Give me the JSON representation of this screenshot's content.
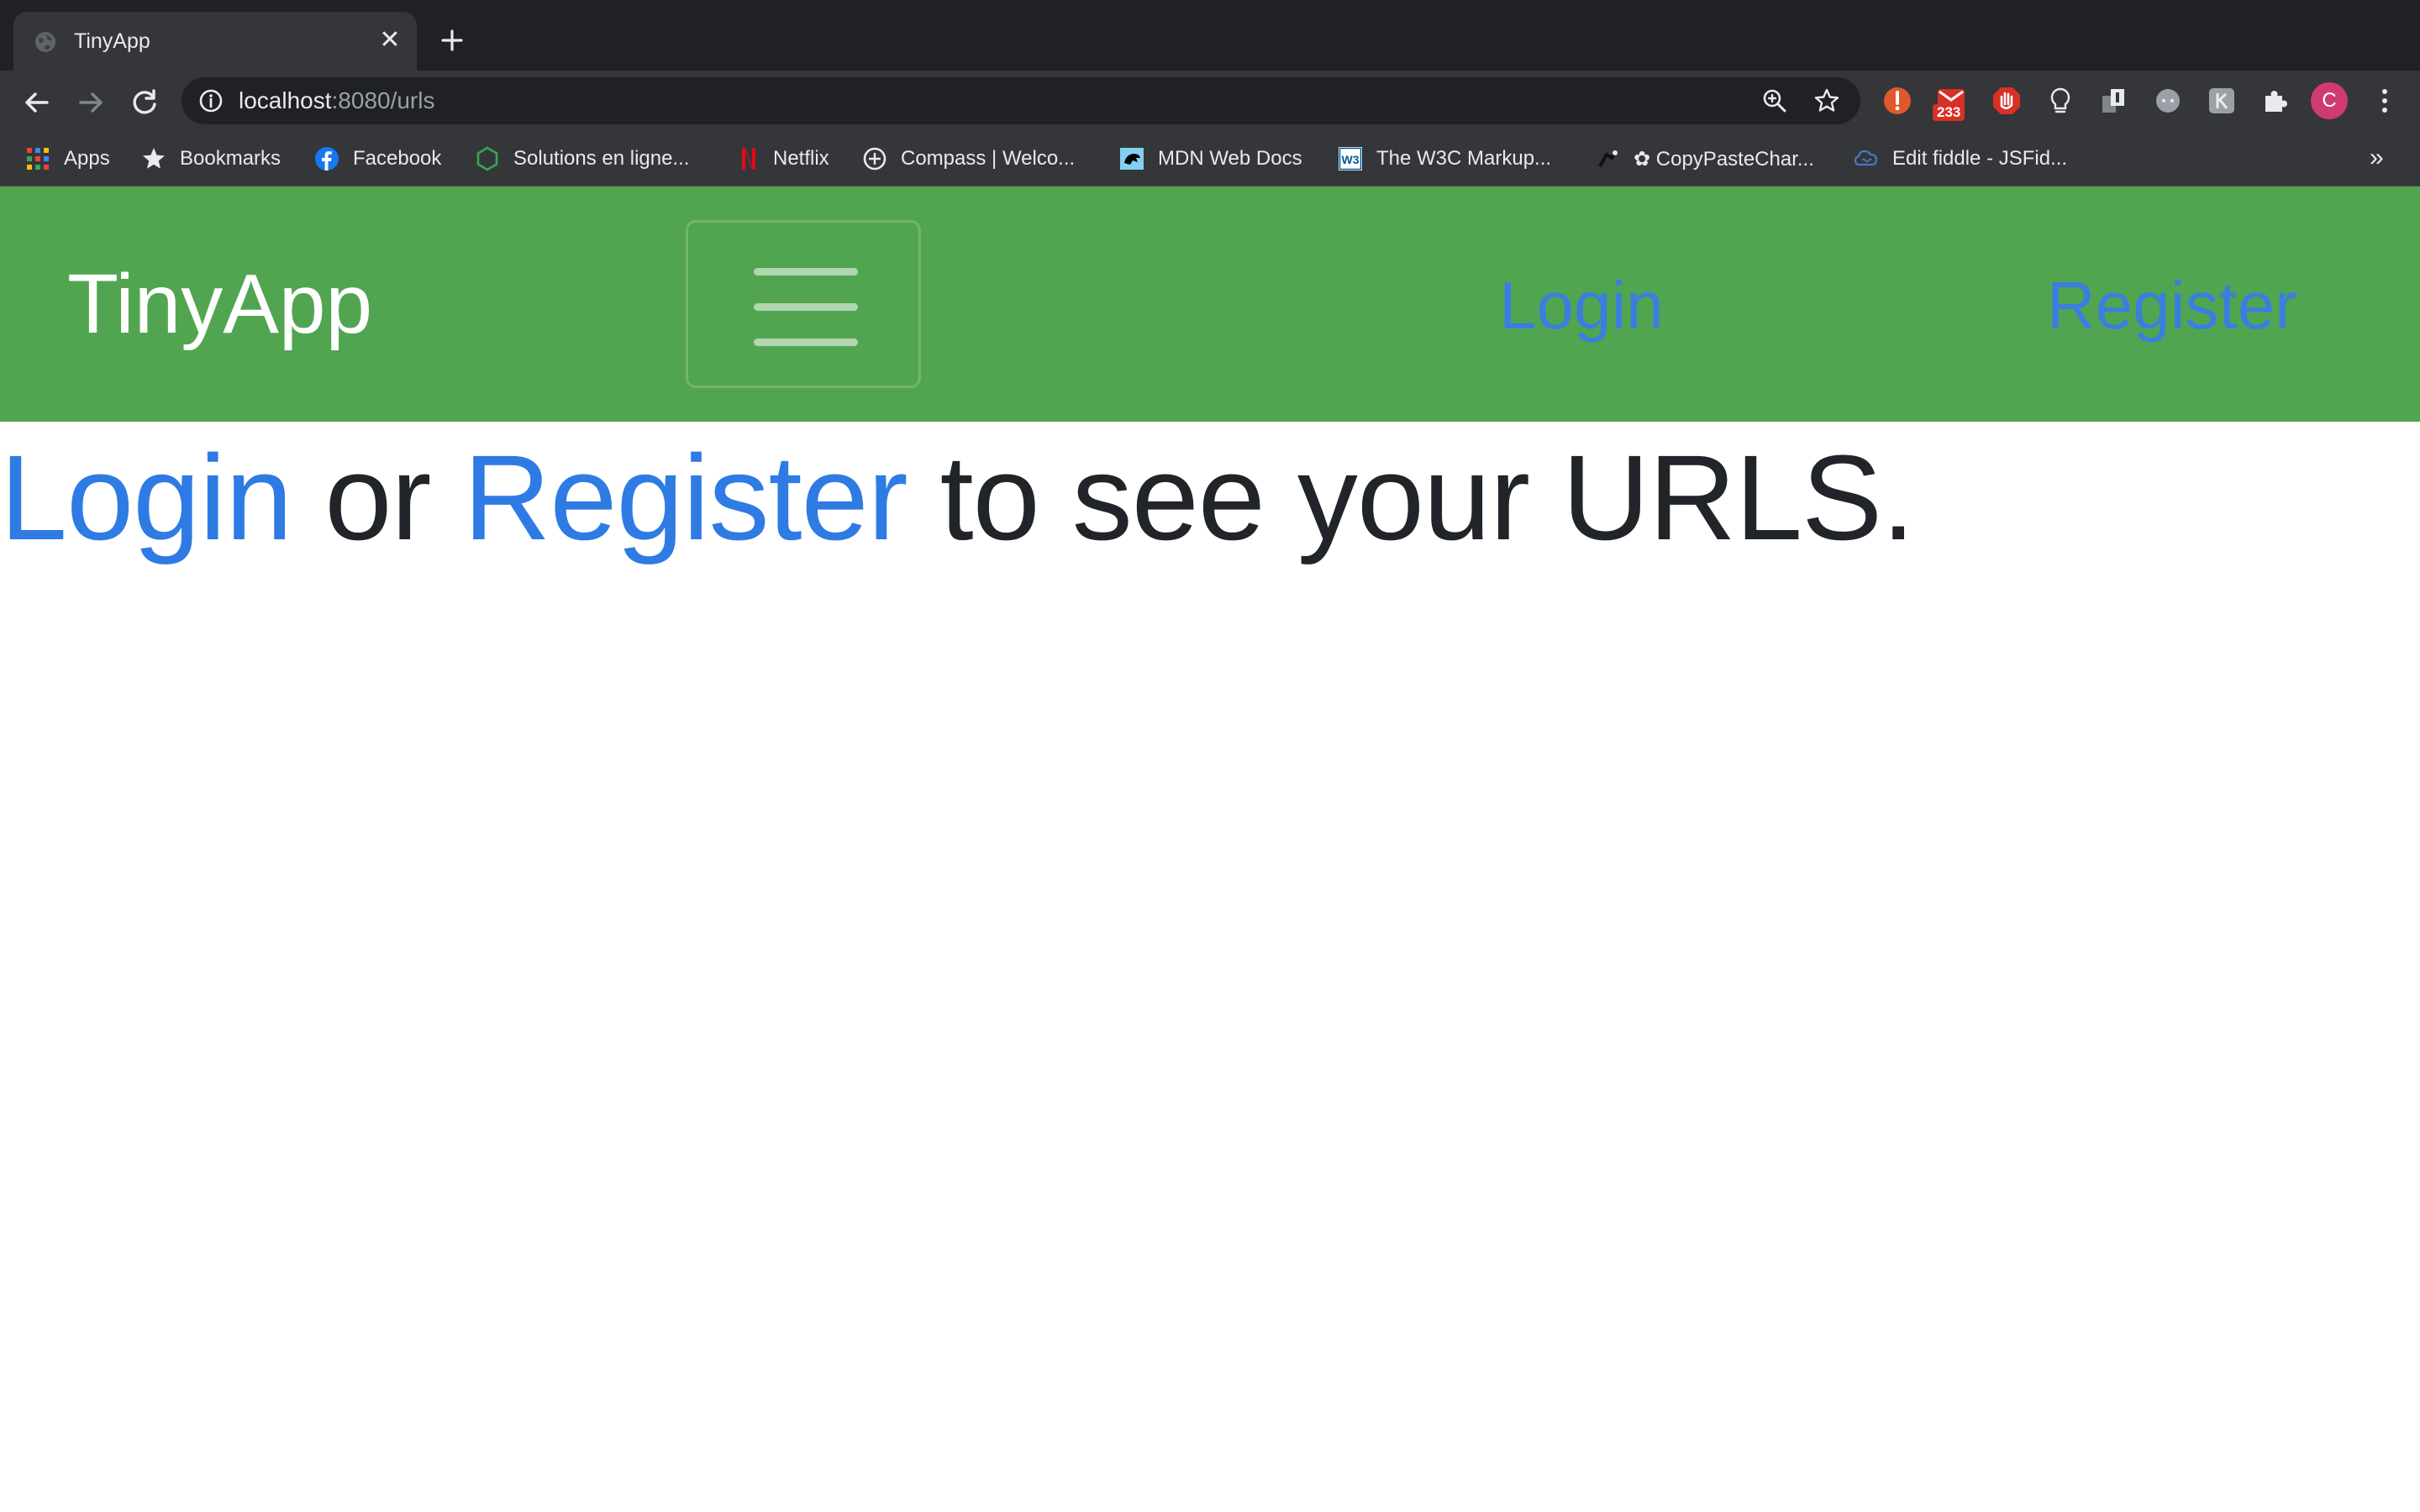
{
  "browser": {
    "tab": {
      "title": "TinyApp",
      "close_glyph": "✕",
      "favicon": "globe-icon"
    },
    "new_tab_glyph": "+",
    "url": {
      "host": "localhost",
      "rest": ":8080/urls"
    },
    "extensions_badge": "233",
    "profile_initial": "C",
    "bookmarks": [
      {
        "label": "Apps",
        "icon": "apps-grid-icon"
      },
      {
        "label": "Bookmarks",
        "icon": "star-icon"
      },
      {
        "label": "Facebook",
        "icon": "facebook-icon"
      },
      {
        "label": "Solutions en ligne...",
        "icon": "hexagon-icon"
      },
      {
        "label": "Netflix",
        "icon": "netflix-icon"
      },
      {
        "label": "Compass | Welco...",
        "icon": "compass-icon"
      },
      {
        "label": "MDN Web Docs",
        "icon": "mdn-icon"
      },
      {
        "label": "The W3C Markup...",
        "icon": "w3c-icon"
      },
      {
        "label": "✿ CopyPasteChar...",
        "icon": "copypaste-icon"
      },
      {
        "label": "Edit fiddle - JSFid...",
        "icon": "jsfiddle-icon"
      }
    ],
    "bookmarks_overflow": "»"
  },
  "navbar": {
    "brand": "TinyApp",
    "login_label": "Login",
    "register_label": "Register"
  },
  "main": {
    "login_link": "Login",
    "or_text": " or ",
    "register_link": "Register",
    "suffix_text": " to see your URLS."
  },
  "colors": {
    "navbar_bg": "#52a550",
    "link": "#2f7be4",
    "text": "#212529"
  }
}
